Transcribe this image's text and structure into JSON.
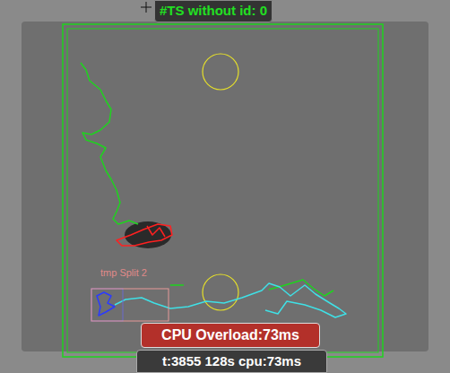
{
  "overlay_title": "#TS without id: 0",
  "split_label": "tmp Split 2",
  "alert": "CPU Overload:73ms",
  "status": "t:3855 128s cpu:73ms",
  "tracks": [
    {
      "color": "#1ed41e"
    },
    {
      "color": "#ff2020"
    },
    {
      "color": "#2b3bff"
    },
    {
      "color": "#3fe0e6"
    }
  ],
  "zones": [
    {
      "color": "#e6e02a"
    },
    {
      "color": "#e6e02a"
    }
  ]
}
